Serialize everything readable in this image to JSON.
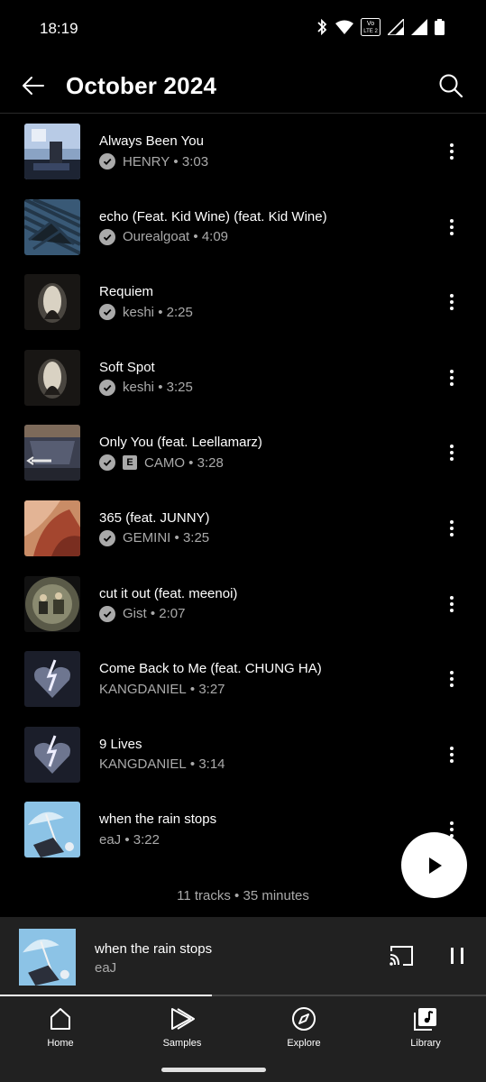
{
  "status_bar": {
    "time": "18:19",
    "volte_label_top": "Vo",
    "volte_label_bottom": "LTE 2"
  },
  "header": {
    "title": "October 2024"
  },
  "tracks": [
    {
      "title": "Always Been You",
      "artist": "HENRY",
      "duration": "3:03",
      "downloaded": true,
      "explicit": false
    },
    {
      "title": "echo (Feat. Kid Wine) (feat. Kid Wine)",
      "artist": "Ourealgoat",
      "duration": "4:09",
      "downloaded": true,
      "explicit": false
    },
    {
      "title": "Requiem",
      "artist": "keshi",
      "duration": "2:25",
      "downloaded": true,
      "explicit": false
    },
    {
      "title": "Soft Spot",
      "artist": "keshi",
      "duration": "3:25",
      "downloaded": true,
      "explicit": false
    },
    {
      "title": "Only You (feat. Leellamarz)",
      "artist": "CAMO",
      "duration": "3:28",
      "downloaded": true,
      "explicit": true
    },
    {
      "title": "365 (feat. JUNNY)",
      "artist": "GEMINI",
      "duration": "3:25",
      "downloaded": true,
      "explicit": false
    },
    {
      "title": "cut it out (feat. meenoi)",
      "artist": "Gist",
      "duration": "2:07",
      "downloaded": true,
      "explicit": false
    },
    {
      "title": "Come Back to Me (feat. CHUNG HA)",
      "artist": "KANGDANIEL",
      "duration": "3:27",
      "downloaded": false,
      "explicit": false
    },
    {
      "title": "9 Lives",
      "artist": "KANGDANIEL",
      "duration": "3:14",
      "downloaded": false,
      "explicit": false
    },
    {
      "title": "when the rain stops",
      "artist": "eaJ",
      "duration": "3:22",
      "downloaded": false,
      "explicit": false
    }
  ],
  "explicit_badge": "E",
  "meta_separator": "•",
  "summary": "11 tracks • 35 minutes",
  "now_playing": {
    "title": "when the rain stops",
    "artist": "eaJ",
    "progress": 0.436
  },
  "nav": [
    {
      "label": "Home",
      "icon": "home-icon"
    },
    {
      "label": "Samples",
      "icon": "samples-icon"
    },
    {
      "label": "Explore",
      "icon": "explore-icon"
    },
    {
      "label": "Library",
      "icon": "library-icon"
    }
  ]
}
